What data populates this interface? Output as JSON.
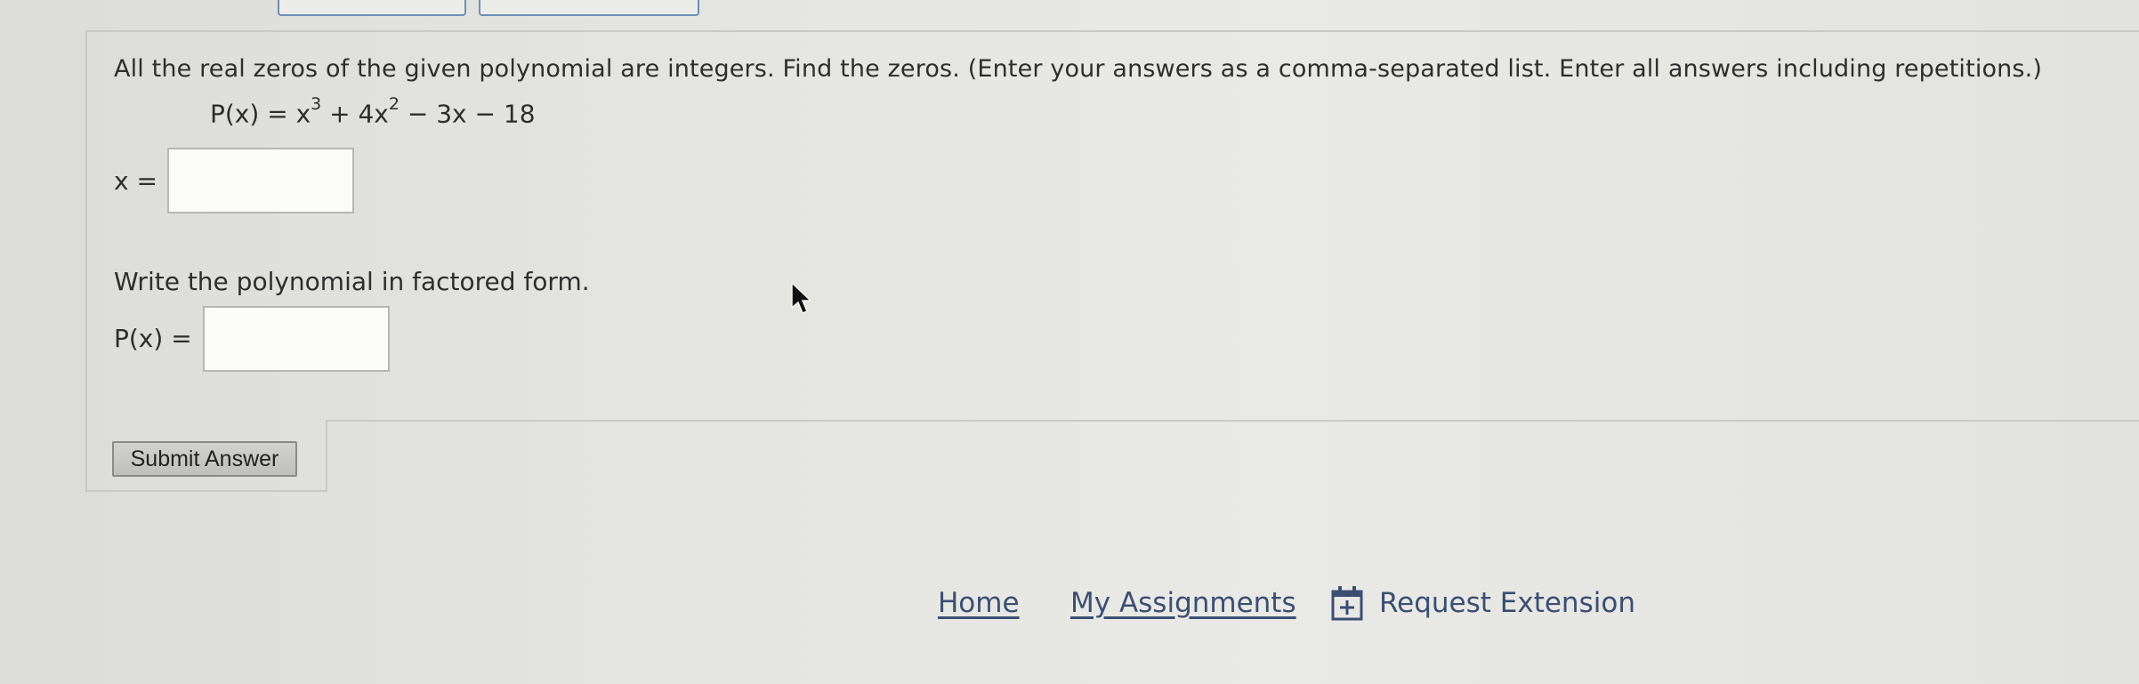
{
  "question": {
    "instruction": "All the real zeros of the given polynomial are integers. Find the zeros. (Enter your answers as a comma-separated list. Enter all answers including repetitions.)",
    "equation_lhs": "P(x) = x",
    "equation_exp1": "3",
    "equation_mid": " + 4x",
    "equation_exp2": "2",
    "equation_tail": " − 3x − 18",
    "zeros_label": "x =",
    "zeros_value": "",
    "factored_prompt": "Write the polynomial in factored form.",
    "factored_label": "P(x) =",
    "factored_value": ""
  },
  "submit_label": "Submit Answer",
  "footer": {
    "home": "Home",
    "my_assignments": "My Assignments",
    "request_extension": "Request Extension"
  },
  "icons": {
    "extension": "calendar-plus-icon",
    "pointer": "mouse-cursor-icon"
  },
  "colors": {
    "link": "#3a4f72",
    "tab_border": "#6e8fb4"
  }
}
